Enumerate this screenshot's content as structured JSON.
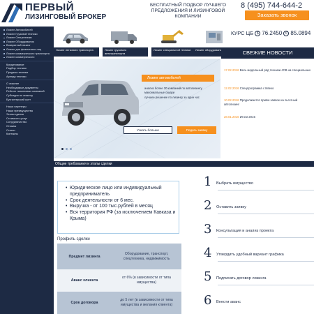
{
  "header": {
    "logo_line1": "ПЕРВЫЙ",
    "logo_line2": "ЛИЗИНГОВЫЙ БРОКЕР",
    "tagline": "БЕСПЛАТНЫЙ ПОДБОР ЛУЧШЕГО ПРЕДЛОЖЕНИЯ И ЛИЗИНГОВОЙ КОМПАНИИ",
    "phone": "8 (495) 744-644-2",
    "callback_label": "Заказать звонок"
  },
  "sidebar": {
    "group1": [
      "Лизинг Автомобилей",
      "Лизинг Грузовой техники",
      "Лизинг Спецтехники",
      "Лизинг Оборудования",
      "Возвратный лизинг",
      "Лизинг для физических лиц",
      "Лизинг коммерческого транспорта",
      "Лизинг коммерческого"
    ],
    "group2": [
      "Кредитование",
      "Подбор техники",
      "Продажа техники",
      "Аренда техники"
    ],
    "group3": [
      "О лизинге",
      "Необходимые документы",
      "Рейтинг лизинговых компаний",
      "Субсидии по лизингу",
      "Бухгалтерский учет"
    ],
    "group4": [
      "Наши партнеры",
      "Наши преимущества",
      "Этапы сделки",
      "Стоимость услуг",
      "Сотрудничество",
      "Отзывы",
      "Статьи",
      "Контакты"
    ]
  },
  "categories": [
    {
      "label": "Лизинг легкового транспорта",
      "icon": "car-icon"
    },
    {
      "label": "Лизинг грузового автотранспорта",
      "icon": "truck-icon"
    },
    {
      "label": "Лизинг специальной техники",
      "icon": "excavator-icon"
    },
    {
      "label": "Лизинг оборудования",
      "icon": "machine-icon"
    }
  ],
  "rate": {
    "label": "КУРС ЦБ",
    "usd": "76.2450",
    "eur": "85.0894",
    "usd_symbol": "$",
    "eur_symbol": "€"
  },
  "hero": {
    "title": "Лизинг автомобилей",
    "lines": [
      "анализ более 30 компаний по автолизингу",
      "максимальные скидки",
      "лучшее решение по лизингу за один час"
    ],
    "more_label": "Узнать больше",
    "apply_label": "Подать заявку"
  },
  "news": {
    "title": "СВЕЖИЕ НОВОСТИ",
    "items": [
      {
        "date": "17.02.2016",
        "text": "Весь модельный ряд техники JCB на специальных"
      },
      {
        "date": "12.02.2016",
        "text": "Спецпрограмма с Ивеко"
      },
      {
        "date": "10.02.2016",
        "text": "Продолжается приём заявок на льготный автолизинг"
      },
      {
        "date": "28.01.2016",
        "text": "Итоги 2015"
      }
    ]
  },
  "section": {
    "title": "Общие требования и этапы сделки"
  },
  "requirements": [
    "Юридическое лицо или индивидуальный предприниматель",
    "Срок деятельности от 6 мес.",
    "Выручка - от 100 тыс.рублей в месяц",
    "Вся территория РФ (за исключением Кавказа и Крыма)"
  ],
  "profile": {
    "title": "Профиль сделки",
    "rows": [
      {
        "key": "Предмет лизинга",
        "value": "Оборудование, транспорт, спецтехника, недвижимость"
      },
      {
        "key": "Аванс клиента",
        "value": "от 6% (в зависимости от типа имущества)"
      },
      {
        "key": "Срок договора",
        "value": "до 5 лет (в зависимости от типа имущества и желания клиента)"
      }
    ]
  },
  "steps": [
    {
      "n": "1",
      "text": "Выбрать имущество"
    },
    {
      "n": "2",
      "text": "Оставить заявку"
    },
    {
      "n": "3",
      "text": "Консультация и анализ проекта"
    },
    {
      "n": "4",
      "text": "Утвердить удобный вариант графика"
    },
    {
      "n": "5",
      "text": "Подписать договор лизинга"
    },
    {
      "n": "6",
      "text": "Внести аванс"
    }
  ],
  "colors": {
    "navy": "#1d2a44",
    "orange": "#f6901e",
    "sky": "#a9cde8"
  }
}
